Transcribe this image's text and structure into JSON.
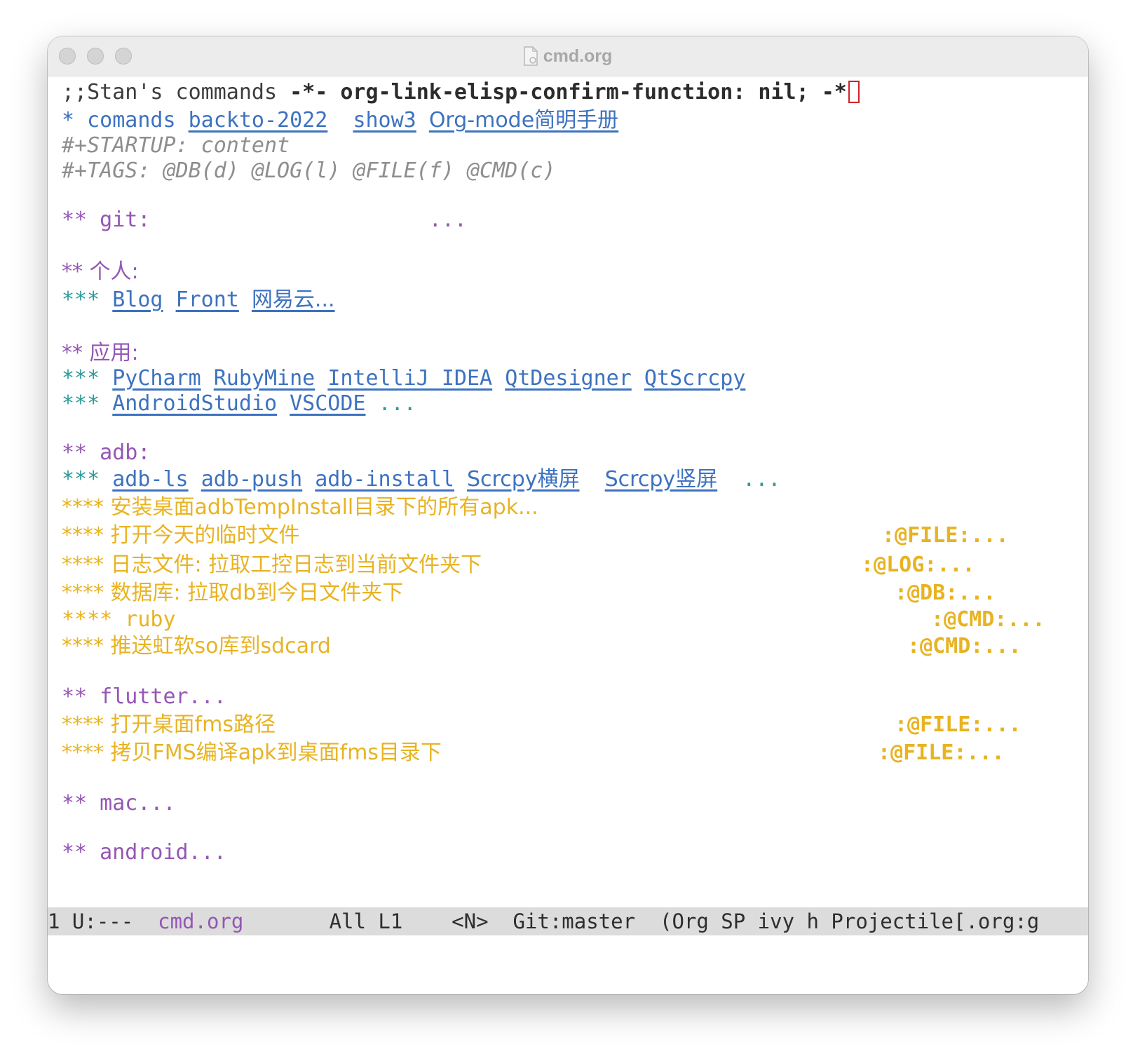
{
  "window": {
    "title": "cmd.org",
    "file_icon": "document-icon"
  },
  "editor": {
    "line1_prefix": ";;Stan's commands ",
    "line1_mode": "-*- org-link-elisp-confirm-function: nil; -*",
    "h1_star": "* comands",
    "h1_links": [
      "backto-2022",
      "show3",
      "Org-mode简明手册"
    ],
    "startup": "#+STARTUP: content",
    "tags_line": "#+TAGS: @DB(d) @LOG(l) @FILE(f) @CMD(c)",
    "git_heading": "** git:",
    "git_ellipsis": "...",
    "personal_heading": "** 个人:",
    "personal_stars": "***",
    "personal_links": [
      "Blog",
      "Front",
      "网易云..."
    ],
    "apps_heading": "** 应用:",
    "apps_row1_stars": "***",
    "apps_row1_links": [
      "PyCharm",
      "RubyMine",
      "IntelliJ IDEA",
      "QtDesigner",
      "QtScrcpy"
    ],
    "apps_row2_stars": "***",
    "apps_row2_links": [
      "AndroidStudio",
      "VSCODE"
    ],
    "apps_row2_ellipsis": "...",
    "adb_heading": "** adb:",
    "adb_stars": "***",
    "adb_links": [
      "adb-ls",
      "adb-push",
      "adb-install",
      "Scrcpy横屏",
      "Scrcpy竖屏"
    ],
    "adb_ellipsis": "...",
    "adb_items": [
      {
        "text": "**** 安装桌面adbTempInstall目录下的所有apk...",
        "tag": ""
      },
      {
        "text": "**** 打开今天的临时文件",
        "tag": ":@FILE:..."
      },
      {
        "text": "**** 日志文件: 拉取工控日志到当前文件夹下",
        "tag": ":@LOG:..."
      },
      {
        "text": "**** 数据库: 拉取db到今日文件夹下",
        "tag": ":@DB:..."
      },
      {
        "text": "**** ruby",
        "tag": ":@CMD:..."
      },
      {
        "text": "**** 推送虹软so库到sdcard",
        "tag": ":@CMD:..."
      }
    ],
    "flutter_heading": "** flutter...",
    "flutter_items": [
      {
        "text": "**** 打开桌面fms路径",
        "tag": ":@FILE:..."
      },
      {
        "text": "**** 拷贝FMS编译apk到桌面fms目录下",
        "tag": ":@FILE:..."
      }
    ],
    "mac_heading": "** mac...",
    "android_heading": "** android..."
  },
  "modeline": {
    "position": "1 U:---  ",
    "buffer": "cmd.org",
    "status": "       All L1    <N>  Git:master  (Org SP ivy h Projectile[.org:g"
  },
  "colors": {
    "heading1": "#3d72c0",
    "heading2": "#9457b4",
    "heading3": "#2e9a9a",
    "heading4": "#e8b323",
    "meta": "#8e8e8e",
    "cursor": "#d0232a"
  }
}
